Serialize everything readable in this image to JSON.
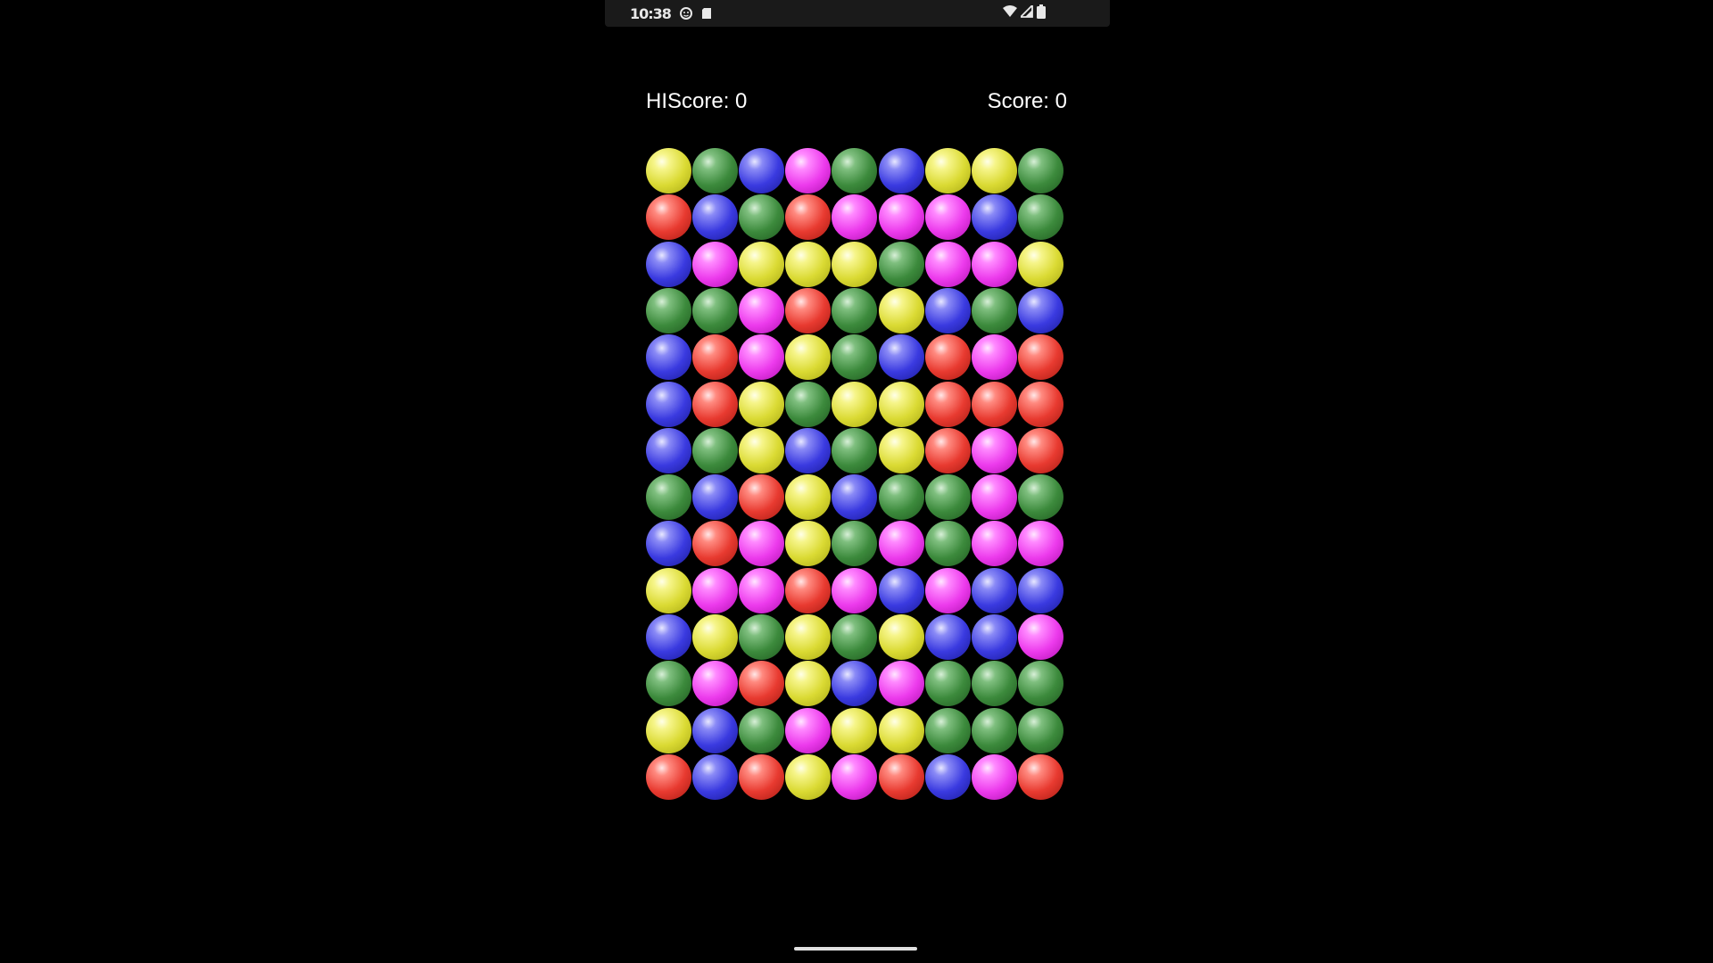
{
  "status_bar": {
    "time": "10:38",
    "left_icons": [
      "face-icon",
      "sd-card-icon"
    ],
    "right_icons": [
      "wifi-icon",
      "signal-icon",
      "battery-icon"
    ]
  },
  "hud": {
    "hiscore_text": "HIScore: 0",
    "score_text": "Score: 0"
  },
  "board": {
    "rows": 14,
    "cols": 9,
    "palette": {
      "Y": "yellow",
      "G": "green",
      "B": "blue",
      "P": "pink",
      "R": "red"
    },
    "grid": [
      "YGBPGBYYG",
      "RBGRPPPBG",
      "BPYYYGPPY",
      "GGPRGYBGB",
      "BRPYGBRPR",
      "BRYGYYRRR",
      "BGYBGYRPR",
      "GBRYBGGPG",
      "BRPYGPGPP",
      "YPPRPBPBB",
      "BYGYGYBBP",
      "GPRYBPGGG",
      "YBGPYYGGG",
      "RBRYPRBPR"
    ]
  }
}
